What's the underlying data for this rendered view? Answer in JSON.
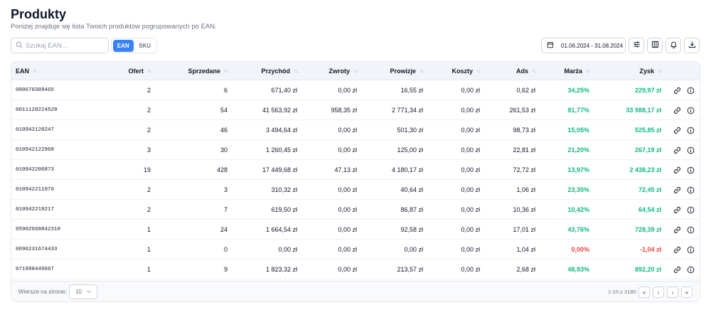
{
  "header": {
    "title": "Produkty",
    "subtitle": "Poniżej znajduje się lista Twoich produktów pogrupowanych po EAN."
  },
  "search": {
    "placeholder": "Szukaj EAN...",
    "value": ""
  },
  "group_toggle": {
    "options": [
      "EAN",
      "SKU"
    ],
    "active": "EAN"
  },
  "date_range": "01.06.2024 - 31.08.2024",
  "toolbar_icons": [
    "calendar-icon",
    "sliders-icon",
    "columns-icon",
    "bell-icon",
    "download-icon"
  ],
  "colors": {
    "accent": "#3b82f6",
    "positive": "#10b981",
    "negative": "#ef4444"
  },
  "table": {
    "columns": [
      "EAN",
      "Ofert",
      "Sprzedane",
      "Przychód",
      "Zwroty",
      "Prowizje",
      "Koszty",
      "Ads",
      "Marża",
      "Zysk"
    ],
    "rows": [
      {
        "ean": "000670309465",
        "ofert": "2",
        "sprzedane": "6",
        "przychod": "671,40 zł",
        "zwroty": "0,00 zł",
        "prowizje": "16,55 zł",
        "koszty": "0,00 zł",
        "ads": "0,62 zł",
        "marza": "34,25%",
        "zysk": "229,97 zł",
        "sign": "pos"
      },
      {
        "ean": "0011120224528",
        "ofert": "2",
        "sprzedane": "54",
        "przychod": "41 563,92 zł",
        "zwroty": "958,35 zł",
        "prowizje": "2 771,34 zł",
        "koszty": "0,00 zł",
        "ads": "261,53 zł",
        "marza": "81,77%",
        "zysk": "33 988,17 zł",
        "sign": "pos"
      },
      {
        "ean": "010942120247",
        "ofert": "2",
        "sprzedane": "46",
        "przychod": "3 494,64 zł",
        "zwroty": "0,00 zł",
        "prowizje": "501,30 zł",
        "koszty": "0,00 zł",
        "ads": "98,73 zł",
        "marza": "15,05%",
        "zysk": "525,85 zł",
        "sign": "pos"
      },
      {
        "ean": "010942122968",
        "ofert": "3",
        "sprzedane": "30",
        "przychod": "1 260,45 zł",
        "zwroty": "0,00 zł",
        "prowizje": "125,00 zł",
        "koszty": "0,00 zł",
        "ads": "22,81 zł",
        "marza": "21,20%",
        "zysk": "267,19 zł",
        "sign": "pos"
      },
      {
        "ean": "010942206873",
        "ofert": "19",
        "sprzedane": "428",
        "przychod": "17 449,68 zł",
        "zwroty": "47,13 zł",
        "prowizje": "4 180,17 zł",
        "koszty": "0,00 zł",
        "ads": "72,72 zł",
        "marza": "13,97%",
        "zysk": "2 438,23 zł",
        "sign": "pos"
      },
      {
        "ean": "010942211976",
        "ofert": "2",
        "sprzedane": "3",
        "przychod": "310,32 zł",
        "zwroty": "0,00 zł",
        "prowizje": "40,64 zł",
        "koszty": "0,00 zł",
        "ads": "1,06 zł",
        "marza": "23,35%",
        "zysk": "72,45 zł",
        "sign": "pos"
      },
      {
        "ean": "010942219217",
        "ofert": "2",
        "sprzedane": "7",
        "przychod": "619,50 zł",
        "zwroty": "0,00 zł",
        "prowizje": "86,87 zł",
        "koszty": "0,00 zł",
        "ads": "10,36 zł",
        "marza": "10,42%",
        "zysk": "64,54 zł",
        "sign": "pos"
      },
      {
        "ean": "05902668842310",
        "ofert": "1",
        "sprzedane": "24",
        "przychod": "1 664,54 zł",
        "zwroty": "0,00 zł",
        "prowizje": "92,58 zł",
        "koszty": "0,00 zł",
        "ads": "17,01 zł",
        "marza": "43,76%",
        "zysk": "728,39 zł",
        "sign": "pos"
      },
      {
        "ean": "0696231674433",
        "ofert": "1",
        "sprzedane": "0",
        "przychod": "0,00 zł",
        "zwroty": "0,00 zł",
        "prowizje": "0,00 zł",
        "koszty": "0,00 zł",
        "ads": "1,04 zł",
        "marza": "0,00%",
        "zysk": "-1,04 zł",
        "sign": "neg"
      },
      {
        "ean": "071990449667",
        "ofert": "1",
        "sprzedane": "9",
        "przychod": "1 823,32 zł",
        "zwroty": "0,00 zł",
        "prowizje": "213,57 zł",
        "koszty": "0,00 zł",
        "ads": "2,68 zł",
        "marza": "48,93%",
        "zysk": "892,20 zł",
        "sign": "pos"
      }
    ]
  },
  "footer": {
    "rows_per_page_label": "Wiersze na stronie:",
    "rows_per_page_value": "10",
    "pager_info": "1-10 z 3180",
    "pager_buttons": [
      "«",
      "‹",
      "›",
      "»"
    ]
  }
}
